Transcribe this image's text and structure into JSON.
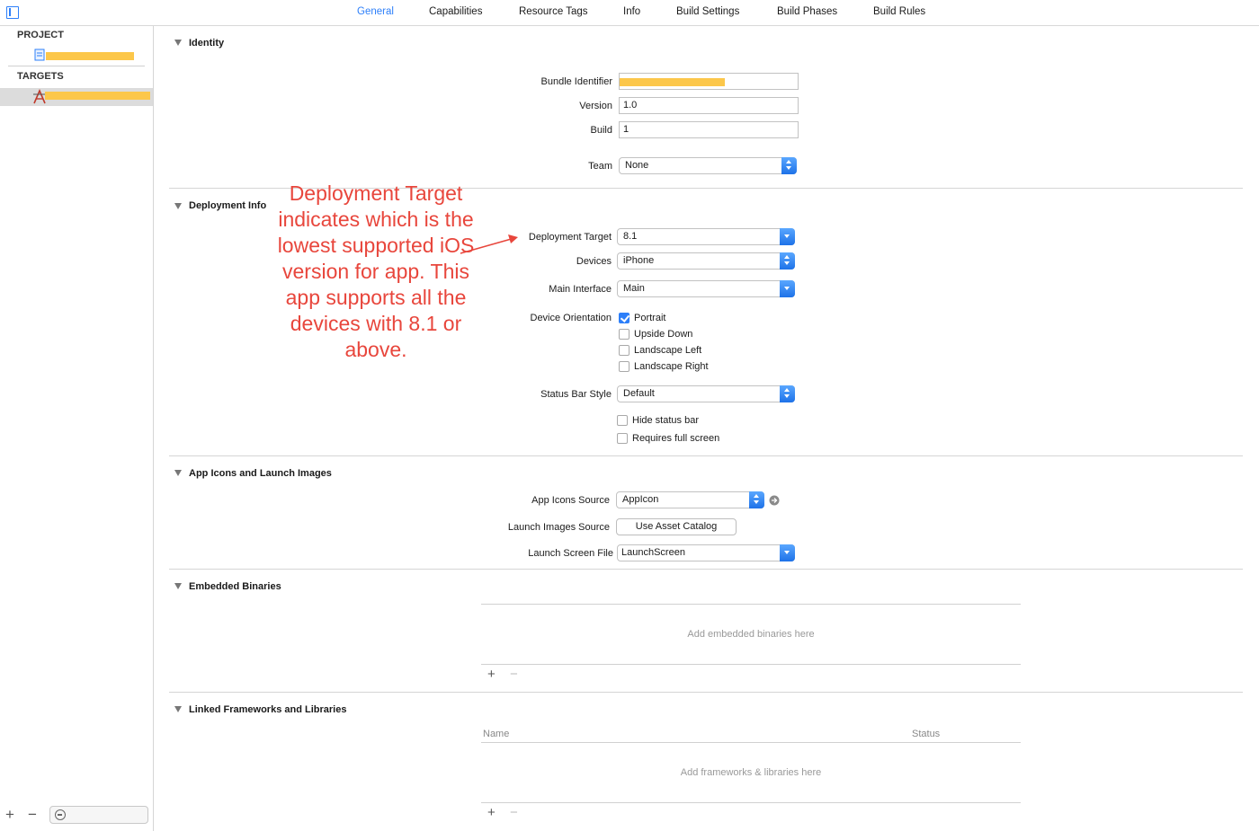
{
  "tabs": [
    "General",
    "Capabilities",
    "Resource Tags",
    "Info",
    "Build Settings",
    "Build Phases",
    "Build Rules"
  ],
  "active_tab": "General",
  "sidebar": {
    "project_header": "PROJECT",
    "targets_header": "TARGETS"
  },
  "identity": {
    "title": "Identity",
    "bundle_identifier_label": "Bundle Identifier",
    "version_label": "Version",
    "version_value": "1.0",
    "build_label": "Build",
    "build_value": "1",
    "team_label": "Team",
    "team_value": "None"
  },
  "deployment": {
    "title": "Deployment Info",
    "target_label": "Deployment Target",
    "target_value": "8.1",
    "devices_label": "Devices",
    "devices_value": "iPhone",
    "main_interface_label": "Main Interface",
    "main_interface_value": "Main",
    "orientation_label": "Device Orientation",
    "orientations": [
      {
        "label": "Portrait",
        "checked": true
      },
      {
        "label": "Upside Down",
        "checked": false
      },
      {
        "label": "Landscape Left",
        "checked": false
      },
      {
        "label": "Landscape Right",
        "checked": false
      }
    ],
    "status_bar_label": "Status Bar Style",
    "status_bar_value": "Default",
    "hide_status_bar": "Hide status bar",
    "requires_full_screen": "Requires full screen"
  },
  "app_icons": {
    "title": "App Icons and Launch Images",
    "icons_source_label": "App Icons Source",
    "icons_source_value": "AppIcon",
    "launch_images_label": "Launch Images Source",
    "launch_images_button": "Use Asset Catalog",
    "launch_screen_label": "Launch Screen File",
    "launch_screen_value": "LaunchScreen"
  },
  "embedded": {
    "title": "Embedded Binaries",
    "placeholder": "Add embedded binaries here"
  },
  "linked": {
    "title": "Linked Frameworks and Libraries",
    "col_name": "Name",
    "col_status": "Status",
    "placeholder": "Add frameworks & libraries here"
  },
  "annotation": "Deployment Target indicates which is the lowest supported iOS version for app. This app supports all the devices with 8.1 or above.",
  "colors": {
    "accent": "#2d7ff9",
    "annotation": "#e8463c",
    "redaction": "#fcc74a"
  }
}
